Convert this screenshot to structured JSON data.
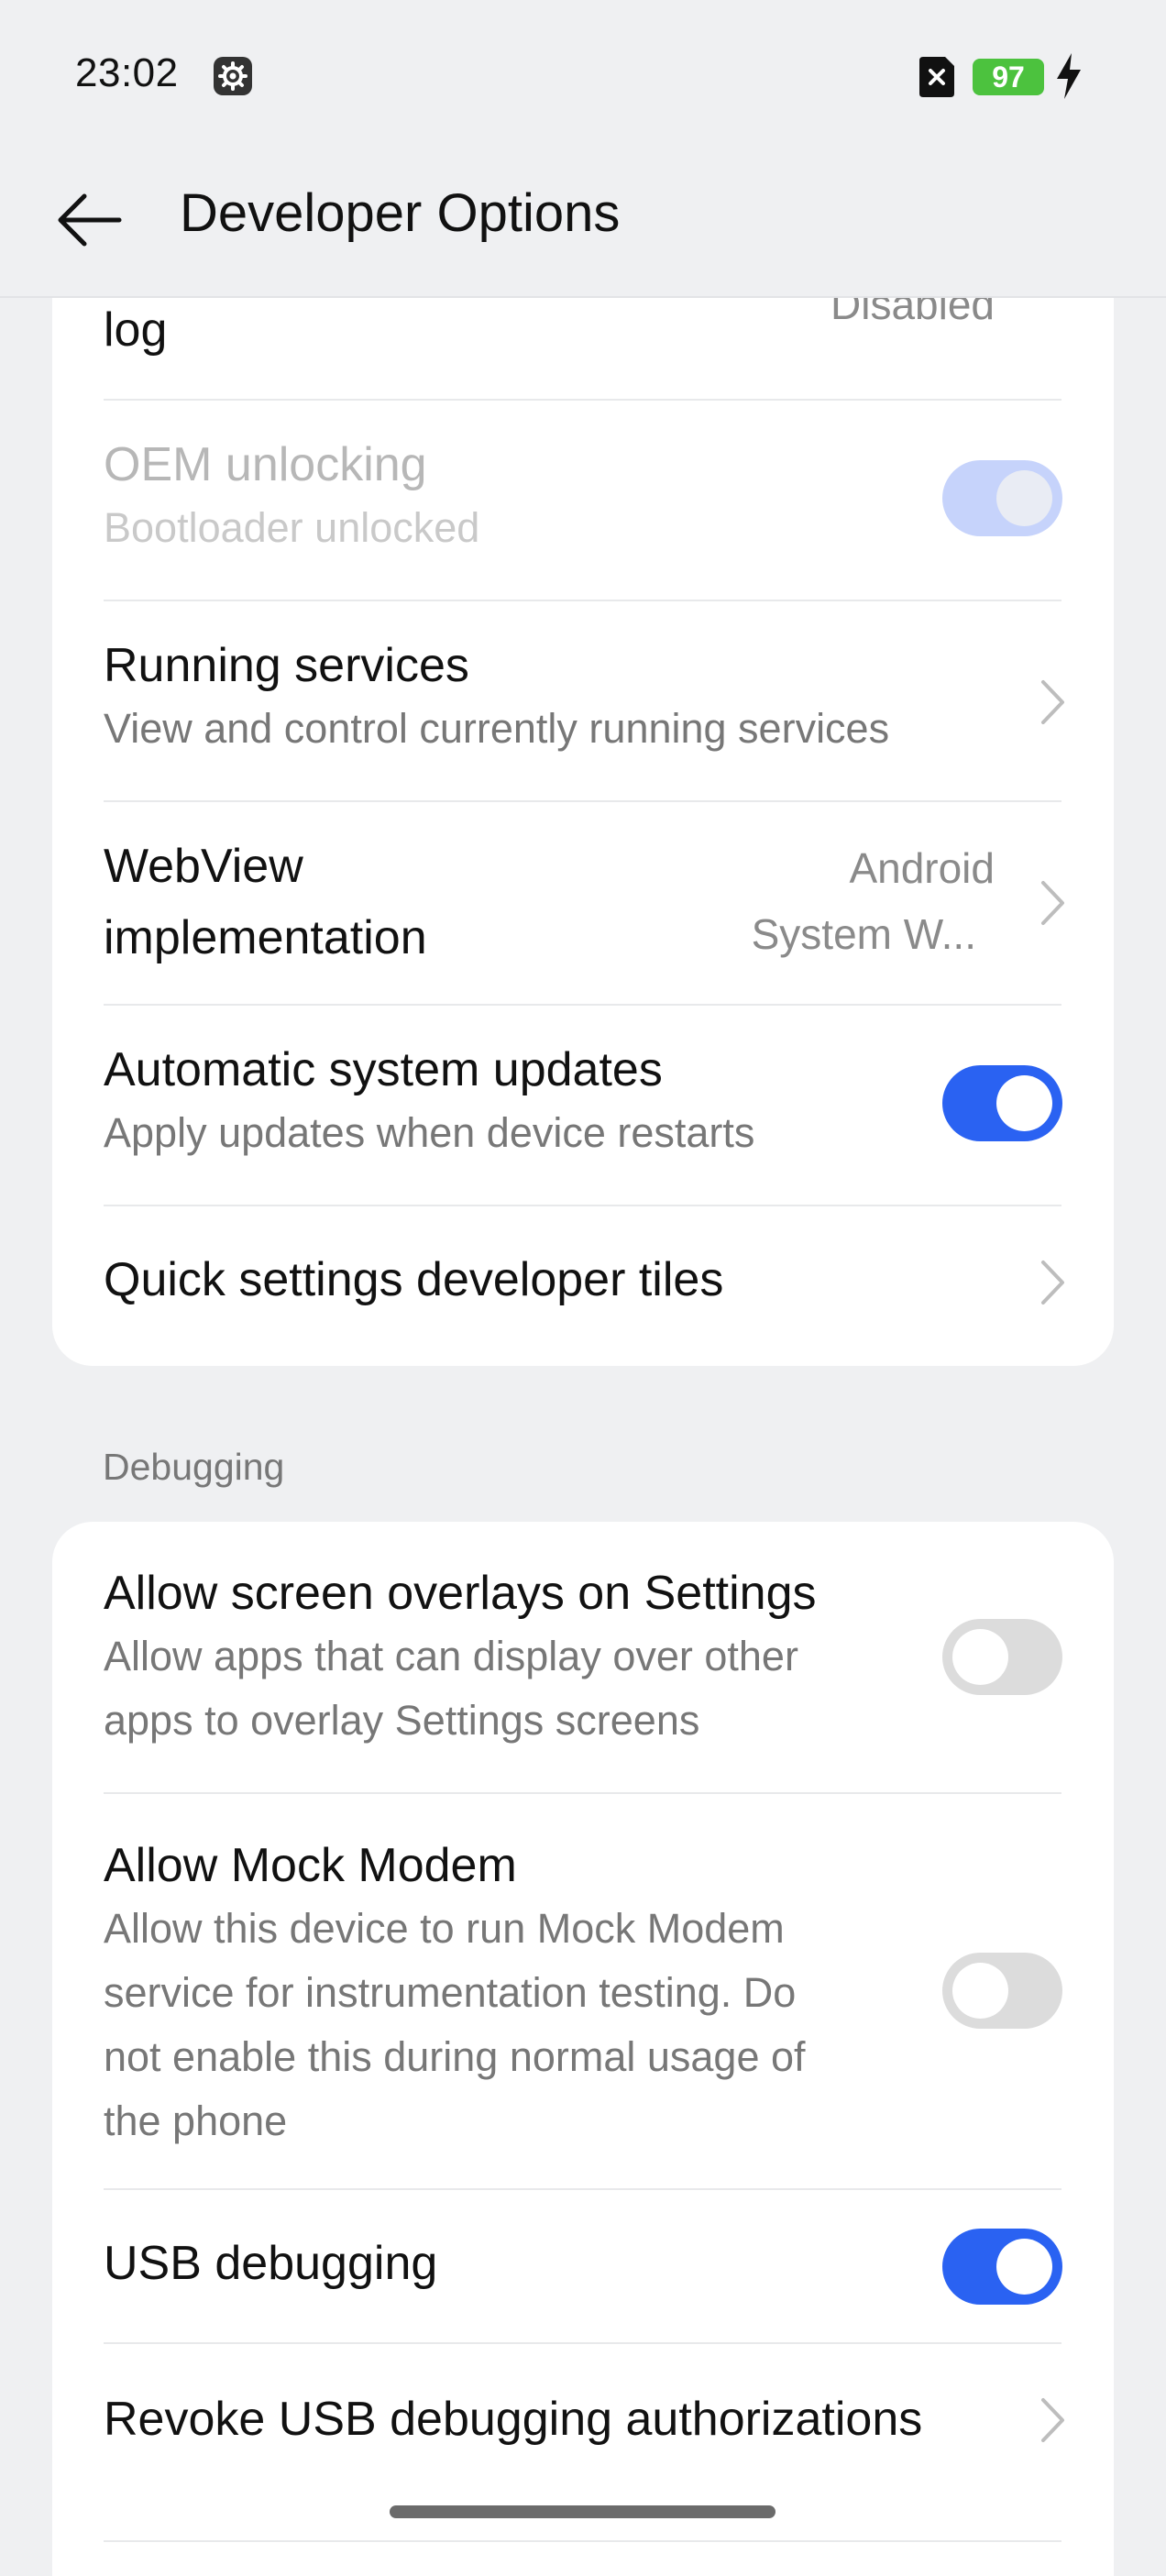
{
  "status": {
    "time": "23:02",
    "battery": "97"
  },
  "header": {
    "title": "Developer Options"
  },
  "card1": {
    "partial_row": {
      "title": "log",
      "value": "Disabled"
    },
    "oem": {
      "title": "OEM unlocking",
      "subtitle": "Bootloader unlocked",
      "toggle": "on-disabled"
    },
    "running": {
      "title": "Running services",
      "subtitle": "View and control currently running services"
    },
    "webview": {
      "title1": "WebView",
      "title2": "implementation",
      "value1": "Android",
      "value2": "System W..."
    },
    "auto_updates": {
      "title": "Automatic system updates",
      "subtitle": "Apply updates when device restarts",
      "toggle": "on"
    },
    "qs_tiles": {
      "title": "Quick settings developer tiles"
    }
  },
  "section": {
    "label": "Debugging"
  },
  "card2": {
    "overlays": {
      "title": "Allow screen overlays on Settings",
      "subtitle1": "Allow apps that can display over other",
      "subtitle2": "apps to overlay Settings screens",
      "toggle": "off"
    },
    "mock_modem": {
      "title": "Allow Mock Modem",
      "subtitle1": "Allow this device to run Mock Modem",
      "subtitle2": "service for instrumentation testing. Do",
      "subtitle3": "not enable this during normal usage of",
      "subtitle4": "the phone",
      "toggle": "off"
    },
    "usb_debugging": {
      "title": "USB debugging",
      "toggle": "on"
    },
    "revoke": {
      "title": "Revoke USB debugging authorizations"
    }
  },
  "colors": {
    "accent": "#2a62f2",
    "battery": "#4cc23e",
    "background": "#eff0f2"
  }
}
